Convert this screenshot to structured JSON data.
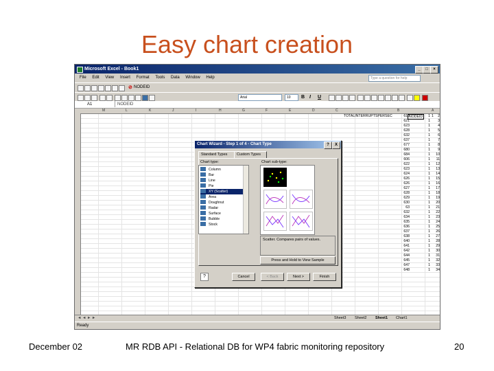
{
  "slide": {
    "title": "Easy chart creation",
    "footer_left": "December 02",
    "footer_center": "MR RDB API - Relational DB for WP4 fabric monitoring repository",
    "footer_right": "20"
  },
  "excel": {
    "window_title": "Microsoft Excel - Book1",
    "menu": [
      "File",
      "Edit",
      "View",
      "Insert",
      "Format",
      "Tools",
      "Data",
      "Window",
      "Help"
    ],
    "help_placeholder": "Type a question for help",
    "toolbar_text": "NODEID",
    "font_name": "Arial",
    "font_size": "10",
    "name_box": "A1",
    "formula_content": "NODEID",
    "columns": [
      "M",
      "L",
      "K",
      "J",
      "I",
      "H",
      "G",
      "F",
      "E",
      "D",
      "C",
      "B",
      "A"
    ],
    "header_cells": {
      "long": "TOTALINTERRUPTSPERSEC",
      "node": "NODEID",
      "p": "1"
    },
    "col_o": [
      "616",
      "621",
      "623",
      "628",
      "632",
      "637",
      "677",
      "680",
      "684",
      "606",
      "622",
      "623",
      "624",
      "626",
      "626",
      "627",
      "628",
      "629",
      "630",
      "63",
      "632",
      "634",
      "635",
      "636",
      "637",
      "638",
      "640",
      "641",
      "642",
      "644",
      "645",
      "647",
      "648"
    ],
    "col_p": [
      "1",
      "1",
      "1",
      "1",
      "1",
      "1",
      "1",
      "1",
      "1",
      "1",
      "1",
      "1",
      "1",
      "1",
      "1",
      "1",
      "1",
      "1",
      "1",
      "1",
      "1",
      "1",
      "1",
      "1",
      "1",
      "1",
      "1",
      "1",
      "1",
      "1",
      "1",
      "1",
      "1"
    ],
    "col_q": [
      "2",
      "3",
      "4",
      "5",
      "6",
      "7",
      "8",
      "9",
      "10",
      "11",
      "12",
      "13",
      "14",
      "15",
      "16",
      "17",
      "18",
      "19",
      "20",
      "21",
      "22",
      "23",
      "24",
      "25",
      "26",
      "27",
      "28",
      "29",
      "30",
      "31",
      "32",
      "33",
      "34"
    ],
    "sheet_tabs": [
      "Sheet3",
      "Sheet2",
      "Sheet1",
      "Chart1"
    ],
    "status": "Ready"
  },
  "dialog": {
    "title": "Chart Wizard - Step 1 of 4 - Chart Type",
    "tabs": [
      "Standard Types",
      "Custom Types"
    ],
    "chart_type_label": "Chart type:",
    "sub_type_label": "Chart sub-type:",
    "chart_types": [
      "Column",
      "Bar",
      "Line",
      "Pie",
      "XY (Scatter)",
      "Area",
      "Doughnut",
      "Radar",
      "Surface",
      "Bubble",
      "Stock"
    ],
    "selected_type": "XY (Scatter)",
    "description": "Scatter. Compares pairs of values.",
    "press_hold_label": "Press and Hold to View Sample",
    "cancel_label": "Cancel",
    "back_label": "< Back",
    "next_label": "Next >",
    "finish_label": "Finish",
    "help_glyph": "?",
    "close_glyph": "X"
  },
  "colors": {
    "title_accent": "#c8501e",
    "titlebar": "#0a246a",
    "selection": "#0a246a"
  }
}
